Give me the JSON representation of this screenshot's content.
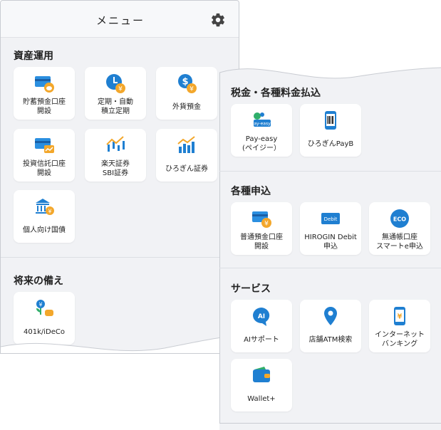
{
  "left_panel": {
    "header": {
      "title": "メニュー",
      "settings_icon": "gear-icon"
    },
    "section_asset": {
      "title": "資産運用",
      "items": [
        {
          "label": "貯蓄預金口座\n開設",
          "icon": "savings-card-icon"
        },
        {
          "label": "定期・自動\n積立定期",
          "icon": "time-deposit-icon"
        },
        {
          "label": "外貨預金",
          "icon": "foreign-currency-icon"
        },
        {
          "label": "投資信託口座\n開設",
          "icon": "investment-trust-icon"
        },
        {
          "label": "楽天証券\nSBI証券",
          "icon": "securities-chart-icon"
        },
        {
          "label": "ひろぎん証券",
          "icon": "hirogin-securities-icon"
        },
        {
          "label": "個人向け国債",
          "icon": "government-bond-icon"
        }
      ]
    },
    "section_future": {
      "title": "将来の備え",
      "items": [
        {
          "label": "401k/iDeCo",
          "icon": "pension-plant-icon"
        }
      ]
    }
  },
  "right_panel": {
    "section_tax": {
      "title": "税金・各種料金払込",
      "items": [
        {
          "label": "Pay-easy\n(ペイジー）",
          "icon": "pay-easy-icon",
          "badge": "ay-easy"
        },
        {
          "label": "ひろぎんPayB",
          "icon": "payb-phone-icon"
        }
      ]
    },
    "section_apply": {
      "title": "各種申込",
      "items": [
        {
          "label": "普通預金口座\n開設",
          "icon": "ordinary-account-icon"
        },
        {
          "label": "HIROGIN Debit\n申込",
          "icon": "debit-card-icon",
          "badge": "Debit"
        },
        {
          "label": "無通帳口座\nスマートe申込",
          "icon": "eco-icon",
          "badge": "ECO"
        }
      ]
    },
    "section_service": {
      "title": "サービス",
      "items": [
        {
          "label": "AIサポート",
          "icon": "ai-chat-icon",
          "badge": "AI"
        },
        {
          "label": "店舗ATM検索",
          "icon": "location-pin-icon"
        },
        {
          "label": "インターネット\nバンキング",
          "icon": "smartphone-yen-icon"
        },
        {
          "label": "Wallet+",
          "icon": "wallet-icon"
        }
      ]
    }
  },
  "colors": {
    "accent_blue": "#1f7fd1",
    "accent_orange": "#f0a020",
    "tile_bg": "#ffffff",
    "panel_bg": "#f1f2f5"
  }
}
